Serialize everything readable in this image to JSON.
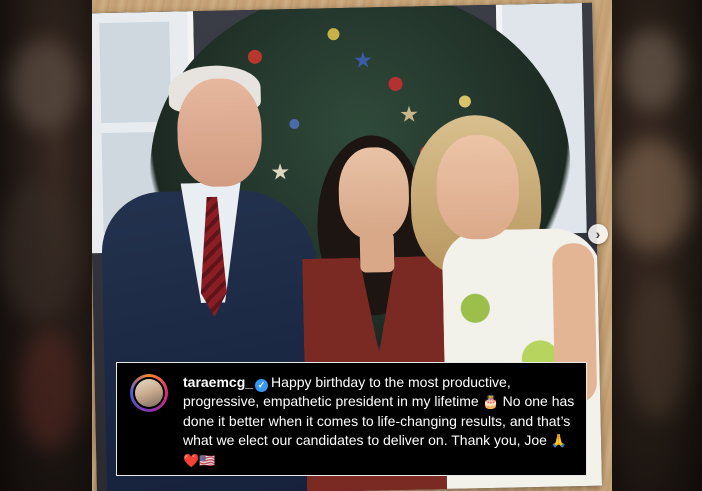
{
  "post": {
    "username": "taraemcg_",
    "verified": true,
    "caption_part1": "Happy birthday to the most productive, progressive, empathetic president in my lifetime",
    "emoji_cake": "🎂",
    "caption_part2": "No one has done it better when it comes to life-changing results, and that’s what we elect our candidates to deliver on. Thank you, Joe",
    "emoji_end": "🙏❤️🇺🇸"
  },
  "icons": {
    "verified": "verified-badge-icon",
    "next": "chevron-right-icon"
  },
  "colors": {
    "caption_bg": "#000000",
    "caption_border": "#e8e8e8",
    "verified_blue": "#3897f0",
    "text": "#ffffff"
  }
}
